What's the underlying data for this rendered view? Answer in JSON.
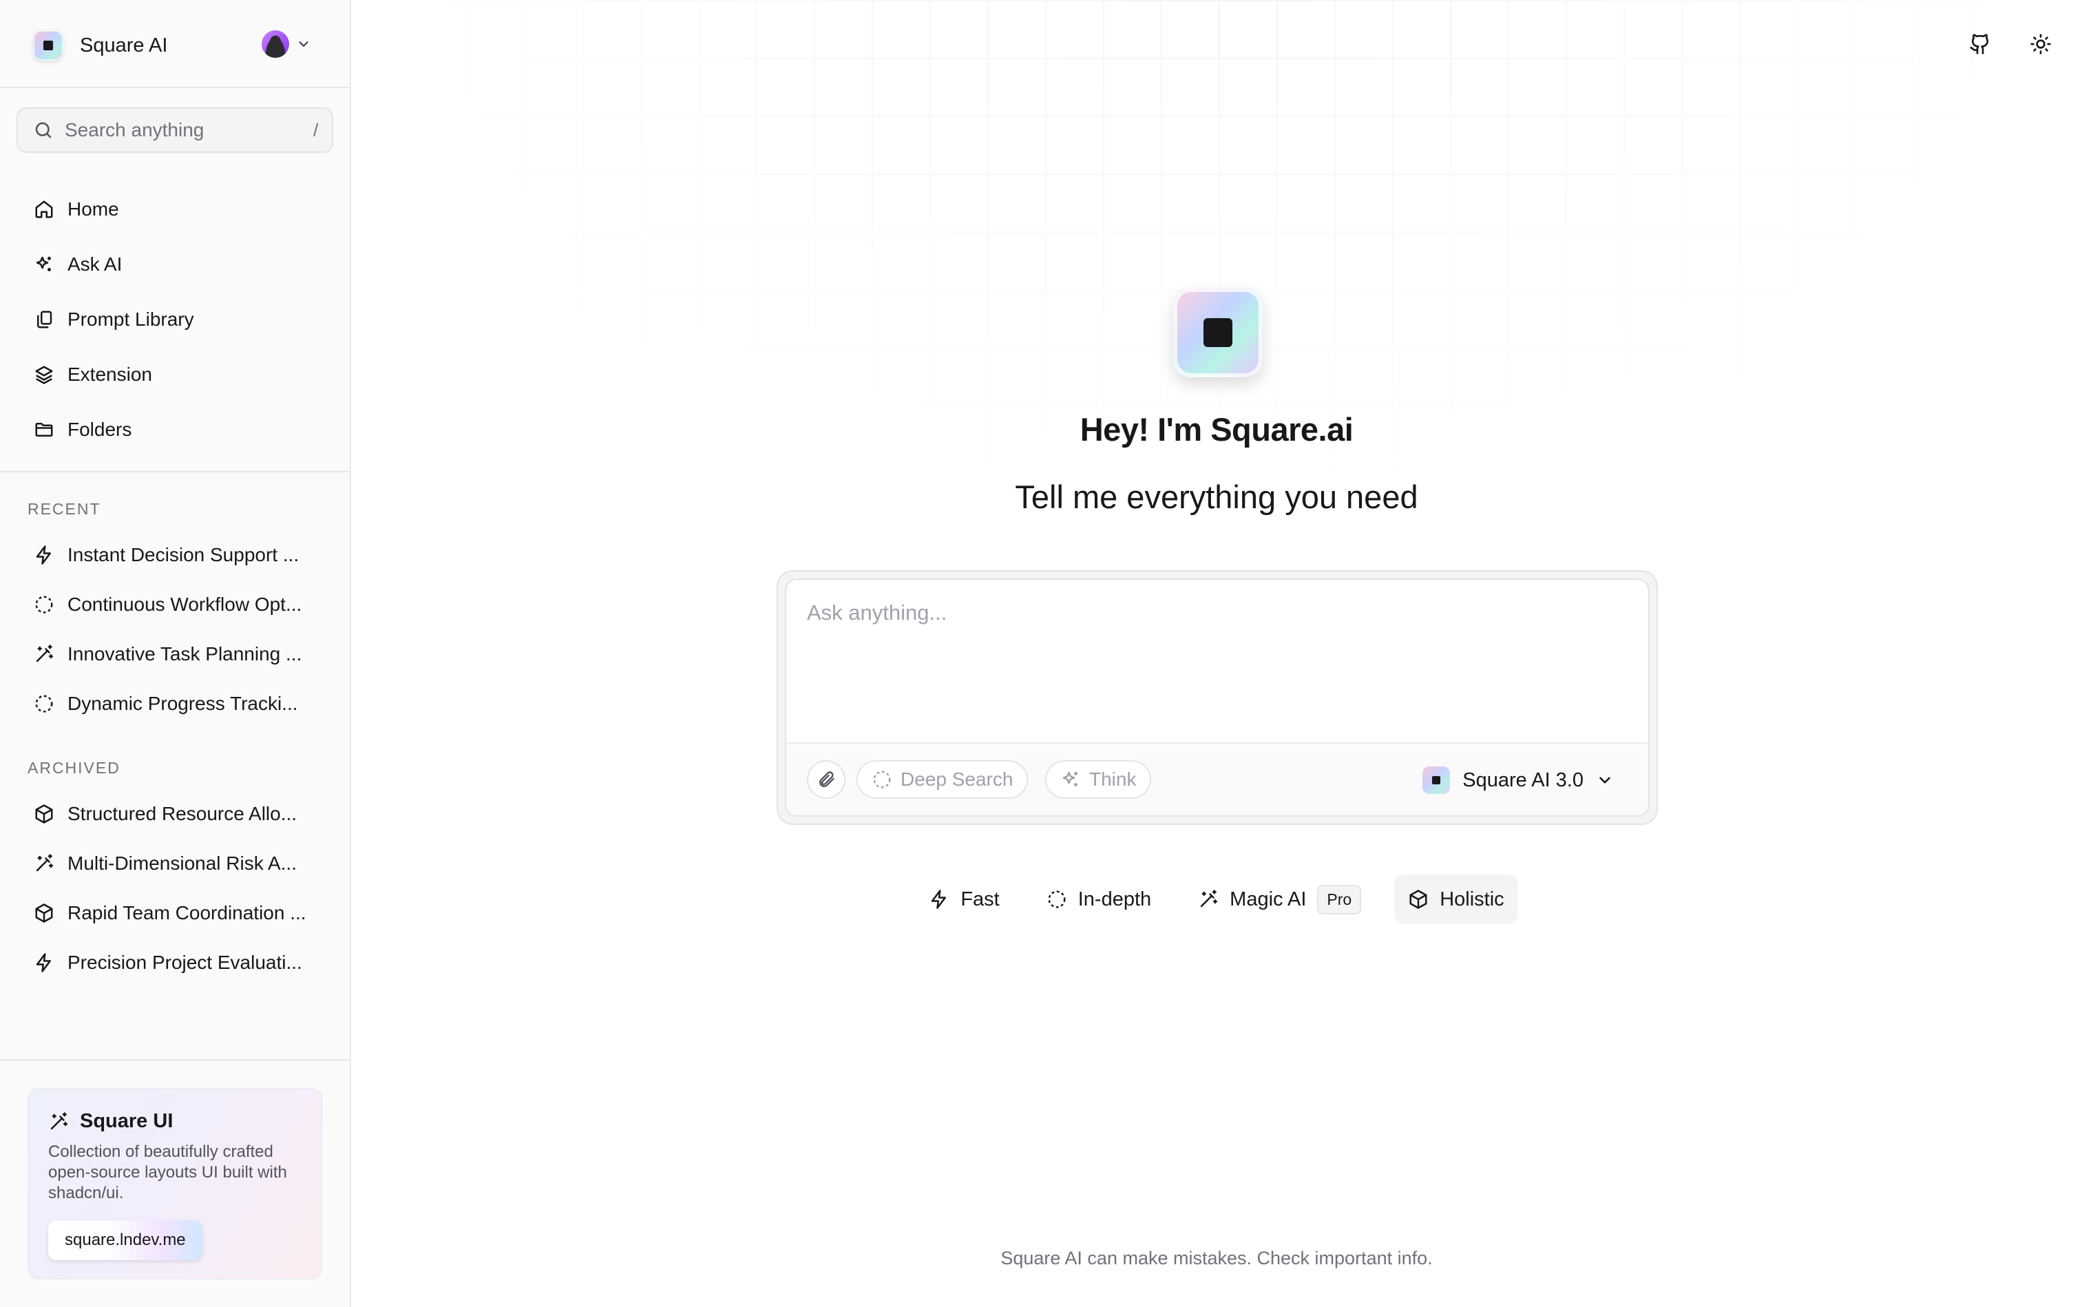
{
  "sidebar": {
    "brand": {
      "name": "Square AI"
    },
    "search": {
      "placeholder": "Search anything",
      "shortcut": "/"
    },
    "nav": [
      {
        "label": "Home",
        "icon": "home-icon"
      },
      {
        "label": "Ask AI",
        "icon": "sparkles-icon"
      },
      {
        "label": "Prompt Library",
        "icon": "library-icon"
      },
      {
        "label": "Extension",
        "icon": "layers-icon"
      },
      {
        "label": "Folders",
        "icon": "folder-icon"
      }
    ],
    "recent": {
      "label": "RECENT",
      "items": [
        {
          "label": "Instant Decision Support ...",
          "icon": "zap-icon"
        },
        {
          "label": "Continuous Workflow Opt...",
          "icon": "loader-circle-icon"
        },
        {
          "label": "Innovative Task Planning ...",
          "icon": "wand-icon"
        },
        {
          "label": "Dynamic Progress Tracki...",
          "icon": "loader-circle-icon"
        }
      ]
    },
    "archived": {
      "label": "ARCHIVED",
      "items": [
        {
          "label": "Structured Resource Allo...",
          "icon": "box-icon"
        },
        {
          "label": "Multi-Dimensional Risk A...",
          "icon": "wand-icon"
        },
        {
          "label": "Rapid Team Coordination ...",
          "icon": "box-icon"
        },
        {
          "label": "Precision Project Evaluati...",
          "icon": "zap-icon"
        }
      ]
    },
    "promo": {
      "title": "Square UI",
      "description": "Collection of beautifully crafted open-source layouts UI built with shadcn/ui.",
      "link": "square.lndev.me"
    }
  },
  "main": {
    "hero": {
      "title": "Hey! I'm Square.ai",
      "subtitle": "Tell me everything you need"
    },
    "composer": {
      "placeholder": "Ask anything...",
      "deep_search": "Deep Search",
      "think": "Think",
      "model": "Square AI 3.0"
    },
    "modes": [
      {
        "label": "Fast",
        "icon": "zap-icon"
      },
      {
        "label": "In-depth",
        "icon": "loader-circle-icon"
      },
      {
        "label": "Magic AI",
        "icon": "wand-icon",
        "badge": "Pro"
      },
      {
        "label": "Holistic",
        "icon": "box-icon",
        "active": true
      }
    ],
    "disclaimer": "Square AI can make mistakes. Check important info."
  },
  "colors": {
    "text": "#18181b",
    "muted": "#71717a",
    "placeholder": "#a1a1aa",
    "sidebar_bg": "#fafafa",
    "border": "#e4e4e7"
  }
}
